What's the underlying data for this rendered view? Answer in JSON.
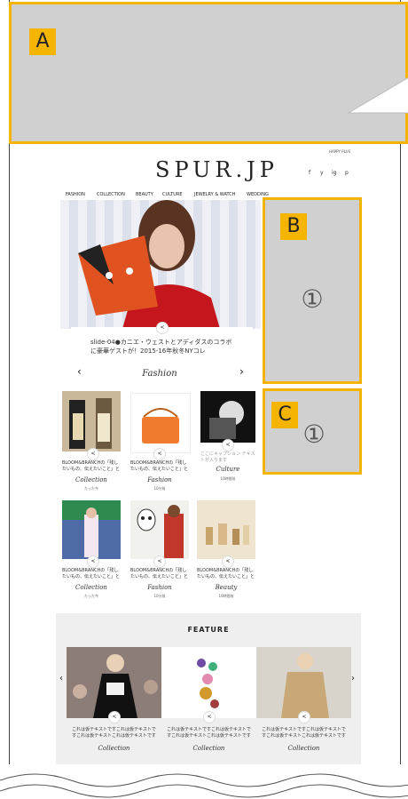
{
  "header": {
    "logo": "SPUR.JP",
    "happy_plus": "HAPPY PLUS",
    "social": [
      "f",
      "y",
      "ig",
      "p"
    ]
  },
  "nav": [
    "FASHION",
    "COLLECTION",
    "BEAUTY",
    "CULTURE",
    "JEWELRY & WATCH",
    "WEDDING"
  ],
  "hero": {
    "caption": "slide-04●カニエ・ウェストとアディダスのコラボに豪華ゲストが！2015-16年秋冬NYコレ",
    "category": "Fashion",
    "prev": "‹",
    "next": "›"
  },
  "grid": [
    {
      "caption": "BLOOM&BRANCHの「残したいもの、伝えたいこと」と",
      "category": "Collection",
      "time": "たった今"
    },
    {
      "caption": "BLOOM&BRANCHの「残したいもの、伝えたいこと」と",
      "category": "Fashion",
      "time": "10分前"
    },
    {
      "caption": "ここにキャプション テキストが入ります",
      "category": "Culture",
      "time": "10時間前"
    },
    {
      "caption": "BLOOM&BRANCHの「残したいもの、伝えたいこと」と",
      "category": "Collection",
      "time": "たった今"
    },
    {
      "caption": "BLOOM&BRANCHの「残したいもの、伝えたいこと」と",
      "category": "Fashion",
      "time": "10分前"
    },
    {
      "caption": "BLOOM&BRANCHの「残したいもの、伝えたいこと」と",
      "category": "Beauty",
      "time": "10時間前"
    }
  ],
  "feature": {
    "title": "FEATURE",
    "items": [
      {
        "caption": "これは仮テキストですこれは仮テキストですこれは仮テキストこれは仮テキストです",
        "category": "Collection"
      },
      {
        "caption": "これは仮テキストですこれは仮テキストですこれは仮テキストこれは仮テキストです",
        "category": "Collection"
      },
      {
        "caption": "これは仮テキストですこれは仮テキストですこれは仮テキストこれは仮テキストです",
        "category": "Collection"
      }
    ]
  },
  "annotations": {
    "a": "A",
    "b": "B",
    "c": "C",
    "b_num": "①",
    "c_num": "①"
  },
  "colors": {
    "annotation_border": "#f5b400",
    "annotation_fill": "#d0d0d0"
  }
}
